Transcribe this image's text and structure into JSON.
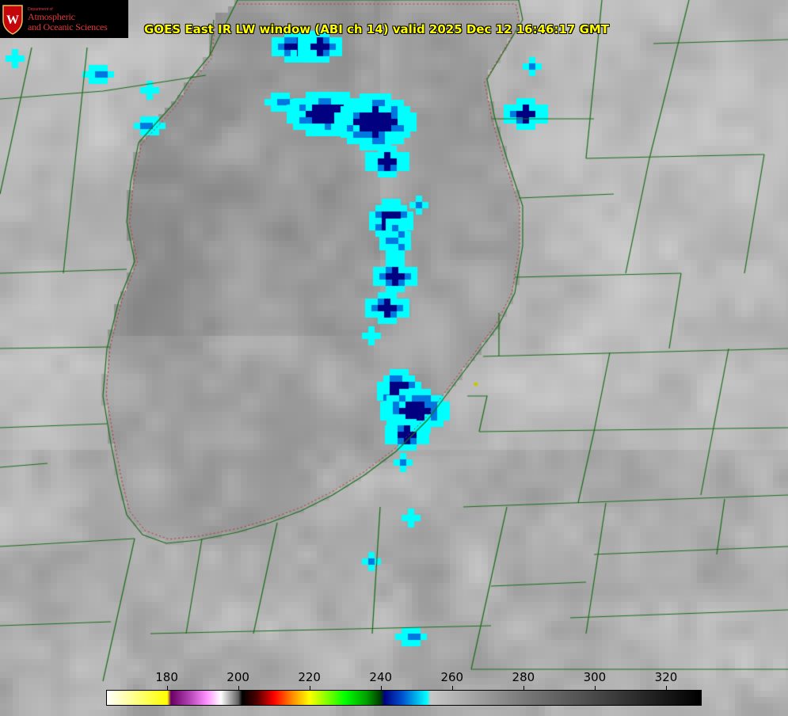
{
  "title": "GOES East IR LW window (ABI ch 14) valid 2025 Dec 12 16:46:17 GMT",
  "logo": {
    "department": "Department of",
    "line1": "Atmospheric",
    "line2": "and Oceanic Sciences",
    "crest_letter": "W"
  },
  "colorbar": {
    "min": 163,
    "max": 330,
    "ticks": [
      "180",
      "200",
      "220",
      "240",
      "260",
      "280",
      "300",
      "320"
    ],
    "stops": [
      {
        "v": 163,
        "c": "#ffffff"
      },
      {
        "v": 180,
        "c": "#ffff00"
      },
      {
        "v": 181,
        "c": "#6a0066"
      },
      {
        "v": 186,
        "c": "#b040b0"
      },
      {
        "v": 191,
        "c": "#ff90ff"
      },
      {
        "v": 195,
        "c": "#ffffff"
      },
      {
        "v": 200,
        "c": "#606060"
      },
      {
        "v": 201,
        "c": "#000000"
      },
      {
        "v": 205,
        "c": "#4a0000"
      },
      {
        "v": 210,
        "c": "#ff0000"
      },
      {
        "v": 215,
        "c": "#ff8800"
      },
      {
        "v": 220,
        "c": "#ffff00"
      },
      {
        "v": 230,
        "c": "#00ff00"
      },
      {
        "v": 236,
        "c": "#00a000"
      },
      {
        "v": 240,
        "c": "#003c00"
      },
      {
        "v": 241,
        "c": "#000080"
      },
      {
        "v": 246,
        "c": "#0050d0"
      },
      {
        "v": 253,
        "c": "#00ffff"
      },
      {
        "v": 254,
        "c": "#c8c8c8"
      },
      {
        "v": 280,
        "c": "#7a7a7a"
      },
      {
        "v": 330,
        "c": "#000000"
      }
    ]
  },
  "colors": {
    "county_border": "#1a6e1a",
    "lake_shore": "#c03030",
    "title": "#ffff00",
    "cold_cloud": "#00ffff",
    "coldest_cloud": "#000080"
  }
}
